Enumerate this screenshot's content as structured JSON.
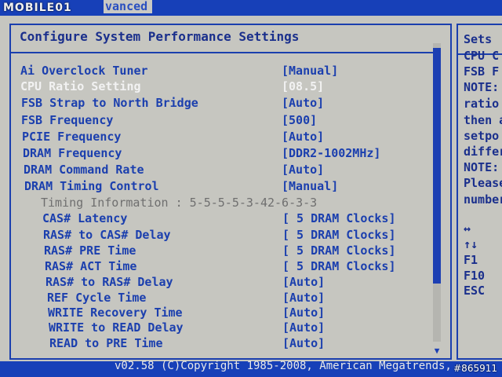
{
  "watermark_logo": "MOBILE01",
  "top_tab": "vanced",
  "title": "Configure System Performance Settings",
  "settings": [
    {
      "label": "Ai Overclock Tuner",
      "value": "[Manual]",
      "state": "normal"
    },
    {
      "label": "CPU Ratio Setting",
      "value": "[08.5]",
      "state": "disabled"
    },
    {
      "label": "FSB Strap to North Bridge",
      "value": "[Auto]",
      "state": "normal"
    },
    {
      "label": "FSB Frequency",
      "value": "[500]",
      "state": "normal"
    },
    {
      "label": "PCIE Frequency",
      "value": "[Auto]",
      "state": "normal"
    },
    {
      "label": "DRAM Frequency",
      "value": "[DDR2-1002MHz]",
      "state": "normal"
    },
    {
      "label": "DRAM Command Rate",
      "value": "[Auto]",
      "state": "normal"
    },
    {
      "label": "DRAM Timing Control",
      "value": "[Manual]",
      "state": "normal"
    }
  ],
  "timing_info": "Timing Information : 5-5-5-5-3-42-6-3-3",
  "timings": [
    {
      "label": "CAS# Latency",
      "value": "[ 5 DRAM Clocks]"
    },
    {
      "label": "RAS# to CAS# Delay",
      "value": "[ 5 DRAM Clocks]"
    },
    {
      "label": "RAS# PRE Time",
      "value": "[ 5 DRAM Clocks]"
    },
    {
      "label": "RAS# ACT Time",
      "value": "[ 5 DRAM Clocks]"
    },
    {
      "label": "RAS# to RAS# Delay",
      "value": "[Auto]"
    },
    {
      "label": "REF Cycle Time",
      "value": "[Auto]"
    },
    {
      "label": "WRITE Recovery Time",
      "value": "[Auto]"
    },
    {
      "label": "WRITE to READ Delay",
      "value": "[Auto]"
    },
    {
      "label": "READ to PRE Time",
      "value": "[Auto]"
    }
  ],
  "help": {
    "title": "Sets",
    "lines": [
      "CPU C",
      "FSB F",
      "NOTE:",
      "ratio",
      "then a",
      "setpo",
      "differ",
      "NOTE:",
      "Please",
      "number"
    ]
  },
  "keys": [
    "↔",
    "↑↓",
    "F1",
    "F10",
    "ESC"
  ],
  "footer": "v02.58 (C)Copyright 1985-2008, American Megatrends,",
  "photo_id": "#865911",
  "colors": {
    "bios_blue": "#1b3fae",
    "panel_gray": "#c6c6c0",
    "disabled_white": "#f2f2f2"
  }
}
